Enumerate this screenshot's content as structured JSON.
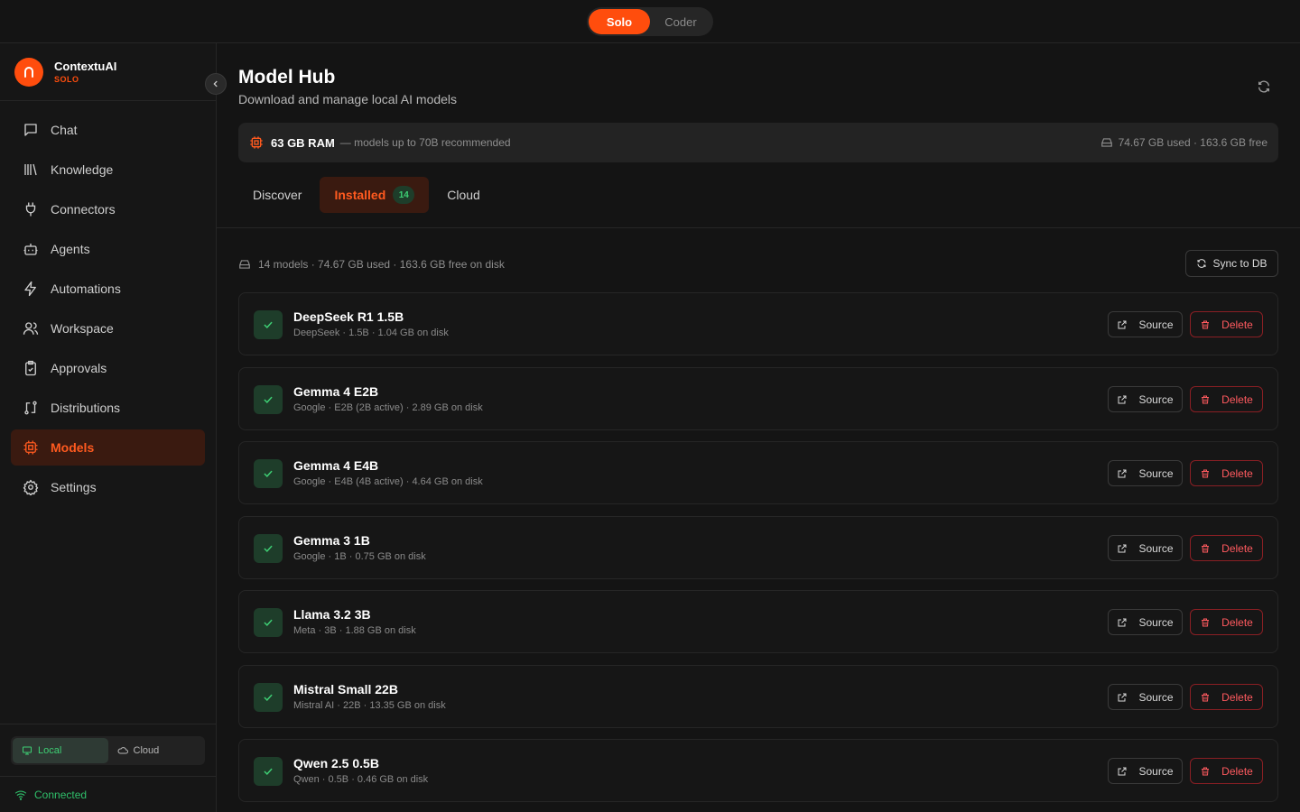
{
  "mode_switch": {
    "solo": "Solo",
    "coder": "Coder"
  },
  "brand": {
    "name": "ContextuAI",
    "edition": "SOLO"
  },
  "sidebar": {
    "items": [
      {
        "label": "Chat",
        "icon": "chat-icon"
      },
      {
        "label": "Knowledge",
        "icon": "library-icon"
      },
      {
        "label": "Connectors",
        "icon": "plug-icon"
      },
      {
        "label": "Agents",
        "icon": "bot-icon"
      },
      {
        "label": "Automations",
        "icon": "zap-icon"
      },
      {
        "label": "Workspace",
        "icon": "users-icon"
      },
      {
        "label": "Approvals",
        "icon": "clipboard-check-icon"
      },
      {
        "label": "Distributions",
        "icon": "route-icon"
      },
      {
        "label": "Models",
        "icon": "cpu-icon",
        "active": true
      },
      {
        "label": "Settings",
        "icon": "gear-icon"
      }
    ],
    "env": {
      "local": "Local",
      "cloud": "Cloud"
    },
    "status": "Connected"
  },
  "page": {
    "title": "Model Hub",
    "subtitle": "Download and manage local AI models"
  },
  "ram_banner": {
    "ram": "63 GB RAM",
    "note": "— models up to 70B recommended",
    "disk": "74.67 GB used · 163.6 GB free"
  },
  "tabs": {
    "discover": "Discover",
    "installed": "Installed",
    "installed_count": "14",
    "cloud": "Cloud"
  },
  "summary": "14 models · 74.67 GB used · 163.6 GB free on disk",
  "sync_label": "Sync to DB",
  "actions": {
    "source": "Source",
    "delete": "Delete"
  },
  "models": [
    {
      "name": "DeepSeek R1 1.5B",
      "meta": "DeepSeek · 1.5B · 1.04 GB on disk"
    },
    {
      "name": "Gemma 4 E2B",
      "meta": "Google · E2B (2B active) · 2.89 GB on disk"
    },
    {
      "name": "Gemma 4 E4B",
      "meta": "Google · E4B (4B active) · 4.64 GB on disk"
    },
    {
      "name": "Gemma 3 1B",
      "meta": "Google · 1B · 0.75 GB on disk"
    },
    {
      "name": "Llama 3.2 3B",
      "meta": "Meta · 3B · 1.88 GB on disk"
    },
    {
      "name": "Mistral Small 22B",
      "meta": "Mistral AI · 22B · 13.35 GB on disk"
    },
    {
      "name": "Qwen 2.5 0.5B",
      "meta": "Qwen · 0.5B · 0.46 GB on disk"
    }
  ],
  "colors": {
    "accent": "#ff4d0d",
    "success": "#3ecf74",
    "danger": "#ff5a5f"
  }
}
